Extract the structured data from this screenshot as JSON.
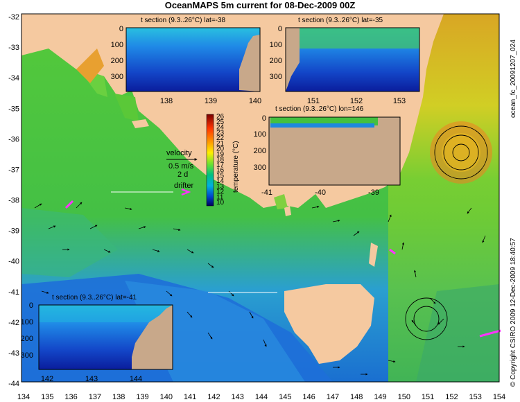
{
  "title": "OceanMAPS 5m current for 08-Dec-2009 00Z",
  "side_text_right": "ocean_fc_20091207_024",
  "side_text_copyright": "© Copyright CSIRO 2009   12-Dec-2009 18:40:57",
  "x_ticks": [
    "134",
    "135",
    "136",
    "137",
    "138",
    "139",
    "140",
    "141",
    "142",
    "143",
    "144",
    "145",
    "146",
    "147",
    "148",
    "149",
    "150",
    "151",
    "152",
    "153",
    "154"
  ],
  "y_ticks": [
    "-32",
    "-33",
    "-34",
    "-35",
    "-36",
    "-37",
    "-38",
    "-39",
    "-40",
    "-41",
    "-42",
    "-43",
    "-44"
  ],
  "legend": {
    "velocity_label": "velocity",
    "speed_label": "0.5 m/s",
    "time_label": "2 d",
    "drifter_label": "drifter",
    "colorbar_title": "temperature (°C)",
    "colorbar_ticks": [
      "26",
      "25",
      "24",
      "23",
      "22",
      "21",
      "20",
      "19",
      "18",
      "17",
      "16",
      "15",
      "14",
      "13",
      "12",
      "11",
      "10"
    ],
    "colors": [
      "#8b0000",
      "#cc0000",
      "#ff3300",
      "#ff6600",
      "#ff9900",
      "#ffcc00",
      "#ffff00",
      "#ccff33",
      "#66ff33",
      "#00cc33",
      "#00cc99",
      "#00cccc",
      "#0099ff",
      "#0066ff",
      "#0033cc",
      "#000099",
      "#000066"
    ]
  },
  "insets": [
    {
      "title": "t section (9.3..26°C) lat=-38",
      "x_ticks": [
        "138",
        "139",
        "140"
      ],
      "y_ticks": [
        "0",
        "100",
        "200",
        "300"
      ]
    },
    {
      "title": "t section (9.3..26°C) lat=-35",
      "x_ticks": [
        "151",
        "152",
        "153"
      ],
      "y_ticks": [
        "0",
        "100",
        "200",
        "300"
      ]
    },
    {
      "title": "t section (9.3..26°C) lon=146",
      "x_ticks": [
        "-41",
        "-40",
        "-39"
      ],
      "y_ticks": [
        "0",
        "100",
        "200",
        "300"
      ]
    },
    {
      "title": "t section (9.3..26°C) lat=-41",
      "x_ticks": [
        "142",
        "143",
        "144"
      ],
      "y_ticks": [
        "0",
        "100",
        "200",
        "300"
      ]
    }
  ],
  "colors": {
    "land": "#f5c9a0",
    "shelf_green": "#4cc83c",
    "deep_blue": "#1e78d0",
    "drifter": "#ff33ff"
  }
}
